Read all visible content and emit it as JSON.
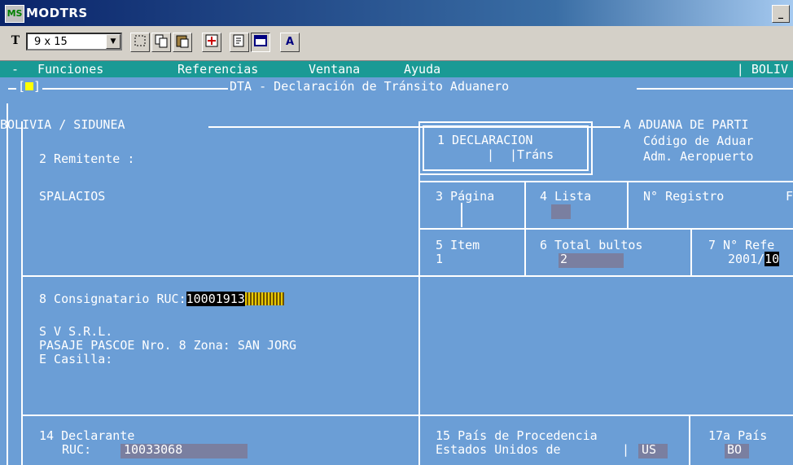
{
  "window": {
    "title": "MODTRS",
    "app_icon": "MS",
    "minimize_glyph": "_"
  },
  "toolbar": {
    "font_icon": "T",
    "font_size": "9 x 15",
    "buttons": [
      "select-icon",
      "copy-icon",
      "paste-icon",
      "fullscreen-icon",
      "properties-icon",
      "background-icon",
      "font-icon"
    ],
    "font_btn_label": "A"
  },
  "menu": {
    "prefix": "-",
    "items": [
      "Funciones",
      "Referencias",
      "Ventana",
      "Ayuda"
    ],
    "status": "| BOLIV"
  },
  "form": {
    "window_title": "DTA - Declaración de Tránsito Aduanero",
    "system": "BOLIVIA / SIDUNEA",
    "aduana_title": "A ADUANA DE PARTI",
    "aduana_code_label": "Código de Aduar",
    "aduana_name": "Adm. Aeropuerto",
    "remitente_label": "2 Remitente :",
    "remitente_value": "SPALACIOS",
    "declaracion_label": "1 DECLARACION",
    "declaracion_sep": "|",
    "declaracion_type": "|Tráns",
    "pagina_label": "3 Página",
    "lista_label": "4 Lista",
    "registro_label": "N° Registro",
    "registro_trunc": "F",
    "item_label": "5 Item",
    "item_value": "1",
    "bultos_label": "6 Total bultos",
    "bultos_value": "2",
    "ref_label": "7 N° Refe",
    "ref_value_a": "2001/",
    "ref_value_b": "10",
    "consignatario_label": "8 Consignatario RUC:",
    "consignatario_ruc": "10001913",
    "consig_line1": "S V S.R.L.",
    "consig_line2": "PASAJE PASCOE Nro. 8 Zona: SAN JORG",
    "consig_line3": "E Casilla:",
    "declarante_label": "14 Declarante",
    "declarante_ruc_label": "RUC:",
    "declarante_ruc": "10033068",
    "procedencia_label": "15 País de Procedencia",
    "procedencia_value": "Estados Unidos de",
    "procedencia_code": "US",
    "pais17_label": "17a País",
    "pais17_value": "BO"
  }
}
